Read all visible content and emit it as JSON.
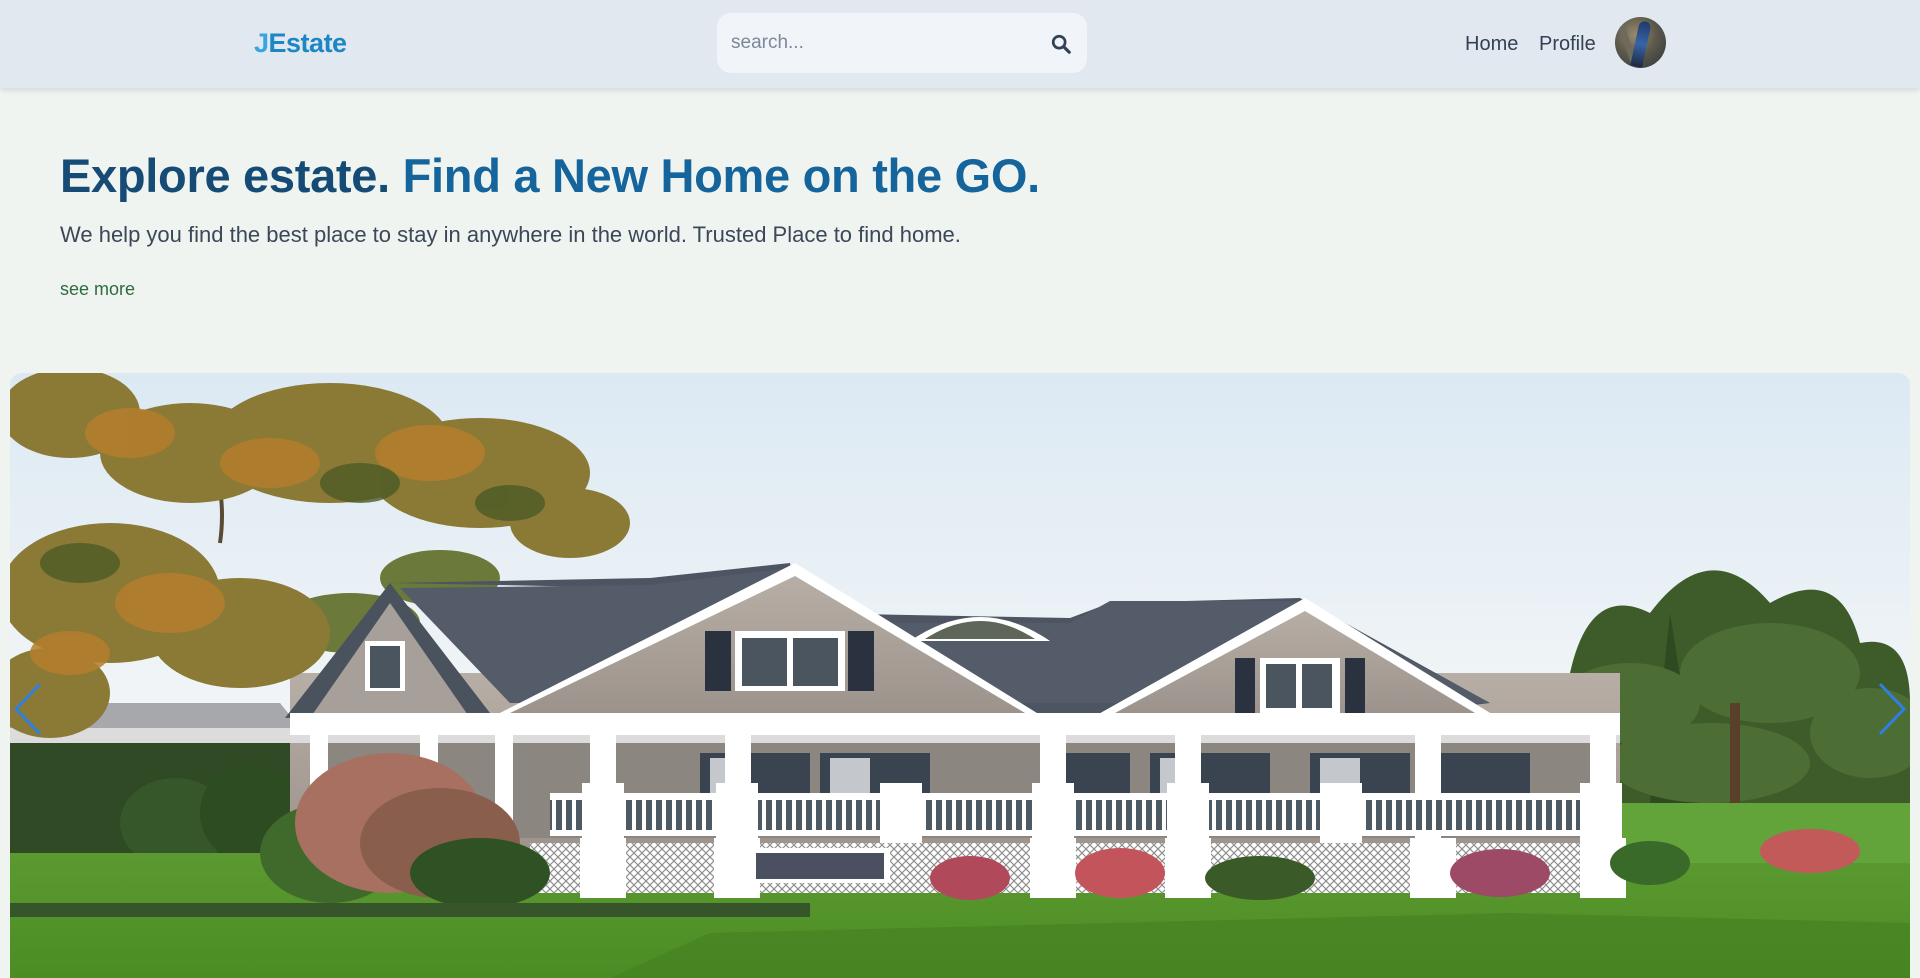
{
  "header": {
    "logo_initial": "J",
    "logo_rest": "Estate",
    "search_placeholder": "search...",
    "nav": {
      "home": "Home",
      "profile": "Profile"
    }
  },
  "hero": {
    "title_part1": "Explore estate. ",
    "title_part2": "Find a New Home on the GO.",
    "subtitle": "We help you find the best place to stay in anywhere in the world. Trusted Place to find home.",
    "see_more": "see more"
  },
  "colors": {
    "header_bg": "#e2e8f0",
    "page_bg": "#eff4f1",
    "logo": "#1d86c4",
    "title_dark": "#154b74",
    "title_accent": "#15649b",
    "link_green": "#2f6b3e",
    "carousel_arrow": "#2f7fe0"
  },
  "icons": {
    "search": "search-icon",
    "carousel_prev": "chevron-left-icon",
    "carousel_next": "chevron-right-icon"
  }
}
